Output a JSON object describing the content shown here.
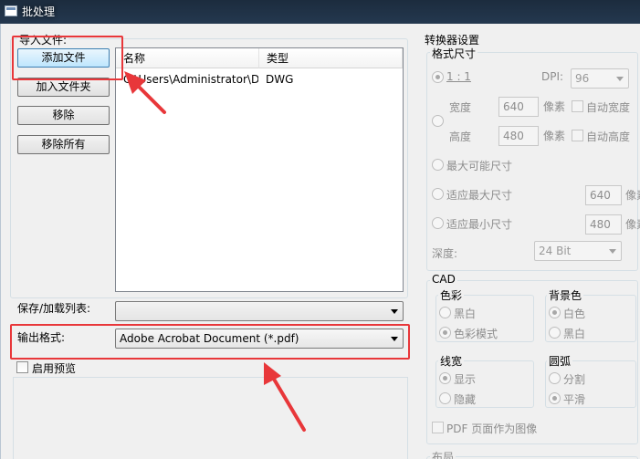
{
  "window": {
    "title": "批处理"
  },
  "import_files": {
    "group_label": "导入文件:",
    "buttons": [
      "添加文件",
      "加入文件夹",
      "移除",
      "移除所有"
    ],
    "columns": [
      "名称",
      "类型"
    ],
    "rows": [
      {
        "name": "C:\\Users\\Administrator\\D...",
        "type": "DWG"
      }
    ]
  },
  "save_load_list": {
    "label": "保存/加载列表:",
    "value": ""
  },
  "output_format": {
    "label": "输出格式:",
    "value": "Adobe Acrobat Document (*.pdf)"
  },
  "preview": {
    "label": "启用预览",
    "checked": false
  },
  "converter_settings": {
    "title": "转换器设置",
    "format_size": {
      "label": "格式尺寸",
      "ratio_label": "1 : 1",
      "dpi_label": "DPI:",
      "dpi_value": "96",
      "width_label": "宽度",
      "width_value": "640",
      "height_label": "高度",
      "height_value": "480",
      "unit_label": "像素",
      "auto_width_label": "自动宽度",
      "auto_height_label": "自动高度",
      "max_possible_label": "最大可能尺寸",
      "fit_max_label": "适应最大尺寸",
      "fit_max_value": "640",
      "fit_min_label": "适应最小尺寸",
      "fit_min_value": "480",
      "unit_cut_label": "像素",
      "depth_label": "深度:",
      "depth_value": "24 Bit"
    },
    "cad": {
      "label": "CAD",
      "color": {
        "label": "色彩",
        "options": [
          "黑白",
          "色彩模式"
        ],
        "selected": "色彩模式"
      },
      "background": {
        "label": "背景色",
        "options": [
          "白色",
          "黑白"
        ],
        "selected": "白色"
      },
      "lineweight": {
        "label": "线宽",
        "options": [
          "显示",
          "隐藏"
        ],
        "selected": "显示"
      },
      "arc": {
        "label": "圆弧",
        "options": [
          "分割",
          "平滑"
        ],
        "selected": "平滑"
      },
      "pdf_page_as_image_label": "PDF 页面作为图像"
    },
    "layout": {
      "label": "布局"
    }
  },
  "colors": {
    "highlight": "#e8373a",
    "titlebar": "#1c2c3e"
  }
}
